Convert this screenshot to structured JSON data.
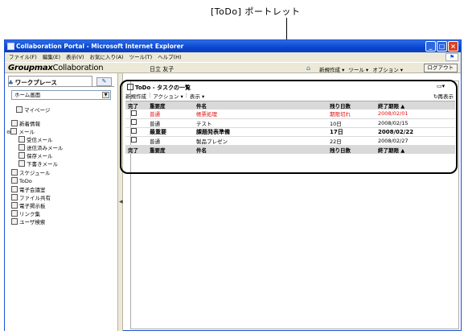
{
  "callout": "[ToDo] ポートレット",
  "window": {
    "title": "Collaboration Portal - Microsoft Internet Explorer",
    "buttons": [
      "_",
      "□",
      "×"
    ]
  },
  "menubar": [
    "ファイル(F)",
    "編集(E)",
    "表示(V)",
    "お気に入り(A)",
    "ツール(T)",
    "ヘルプ(H)"
  ],
  "header": {
    "brand_bold": "Groupmax",
    "brand_light": "Collaboration",
    "username": "日立 友子",
    "menu": [
      "新規作成 ▾",
      "ツール ▾",
      "オプション ▾"
    ],
    "logout": "ログアウト"
  },
  "sidebar": {
    "title": "ワークプレース",
    "select": "ホーム画面",
    "items": [
      {
        "label": "マイページ",
        "icon": "mypage-icon"
      },
      {
        "label": "新着情報",
        "icon": "news-icon"
      },
      {
        "label": "メール",
        "icon": "mail-icon",
        "expander": "⊖"
      },
      {
        "label": "受信メール",
        "icon": "inbox-icon"
      },
      {
        "label": "送信済みメール",
        "icon": "sent-icon"
      },
      {
        "label": "保存メール",
        "icon": "saved-mail-icon"
      },
      {
        "label": "下書きメール",
        "icon": "draft-icon"
      },
      {
        "label": "スケジュール",
        "icon": "schedule-icon"
      },
      {
        "label": "ToDo",
        "icon": "todo-icon"
      },
      {
        "label": "電子会議室",
        "icon": "conference-icon"
      },
      {
        "label": "ファイル共有",
        "icon": "file-share-icon"
      },
      {
        "label": "電子掲示板",
        "icon": "bulletin-icon"
      },
      {
        "label": "リンク集",
        "icon": "links-icon"
      },
      {
        "label": "ユーザ検索",
        "icon": "user-search-icon"
      }
    ]
  },
  "portlet": {
    "title": "ToDo - タスクの一覧",
    "toolbar": [
      "新規作成",
      "アクション ▾",
      "表示 ▾"
    ],
    "refresh": "再表示",
    "columns": [
      "完了",
      "重要度",
      "件名",
      "残り日数",
      "終了期限 ▲"
    ],
    "rows": [
      {
        "done": false,
        "priority": "普通",
        "subject": "帳票処理",
        "remaining": "期限切れ",
        "due": "2008/02/01",
        "style": "red"
      },
      {
        "done": false,
        "priority": "普通",
        "subject": "テスト",
        "remaining": "10日",
        "due": "2008/02/15",
        "style": "normal"
      },
      {
        "done": false,
        "priority": "最重要",
        "subject": "課題発表準備",
        "remaining": "17日",
        "due": "2008/02/22",
        "style": "bold"
      },
      {
        "done": false,
        "priority": "普通",
        "subject": "製品プレゼン",
        "remaining": "22日",
        "due": "2008/02/27",
        "style": "normal"
      }
    ]
  },
  "colors": {
    "titlebar": "#0a46d0",
    "chrome": "#ece9d8",
    "overdue": "#e01010",
    "header_row": "#d9d9d9"
  }
}
